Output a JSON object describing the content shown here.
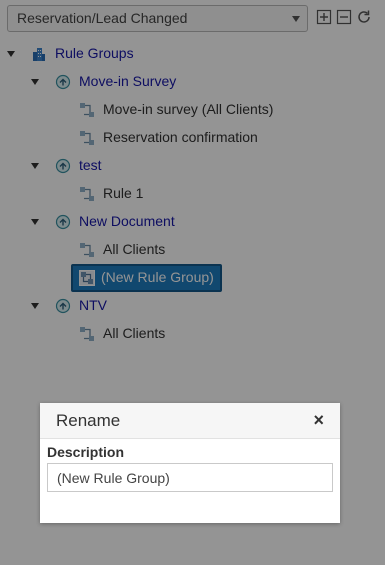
{
  "toolbar": {
    "select_value": "Reservation/Lead Changed",
    "buttons": [
      "expand-all-icon",
      "collapse-all-icon",
      "refresh-icon"
    ]
  },
  "tree": {
    "root": {
      "label": "Rule Groups",
      "icon": "building-icon"
    },
    "groups": [
      {
        "label": "Move-in Survey",
        "rules": [
          "Move-in survey (All Clients)",
          "Reservation confirmation"
        ]
      },
      {
        "label": "test",
        "rules": [
          "Rule 1"
        ]
      },
      {
        "label": "New Document",
        "rules": [
          "All Clients",
          "(New Rule Group)"
        ]
      },
      {
        "label": "NTV",
        "rules": [
          "All Clients"
        ]
      }
    ]
  },
  "dialog": {
    "title": "Rename",
    "close_label": "×",
    "field_label": "Description",
    "field_value": "(New Rule Group)"
  },
  "colors": {
    "link": "#1818a8",
    "selected_bg": "#1e7cc0",
    "overlay": "rgba(0,0,0,0.42)"
  }
}
